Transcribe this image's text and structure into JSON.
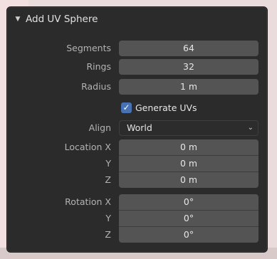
{
  "panel": {
    "title": "Add UV Sphere",
    "collapse_icon": "triangle-down-icon"
  },
  "segments": {
    "label": "Segments",
    "value": "64"
  },
  "rings": {
    "label": "Rings",
    "value": "32"
  },
  "radius": {
    "label": "Radius",
    "value": "1 m"
  },
  "generate_uvs": {
    "label": "Generate UVs",
    "checked": true,
    "check_icon": "checkmark-icon"
  },
  "align": {
    "label": "Align",
    "value": "World",
    "chevron_icon": "chevron-down-icon"
  },
  "location": {
    "label": "Location X",
    "x": "0 m",
    "y_label": "Y",
    "y": "0 m",
    "z_label": "Z",
    "z": "0 m"
  },
  "rotation": {
    "label": "Rotation X",
    "x": "0°",
    "y_label": "Y",
    "y": "0°",
    "z_label": "Z",
    "z": "0°"
  },
  "colors": {
    "panel_bg": "#2b2b2b",
    "field_bg": "#545454",
    "checkbox_accent": "#4772b3",
    "label_text": "#b3b3b3",
    "value_text": "#e6e6e6"
  }
}
